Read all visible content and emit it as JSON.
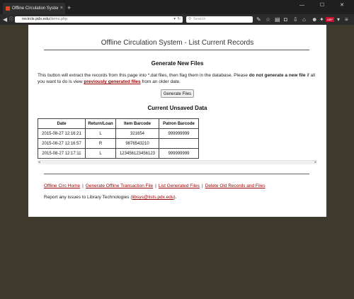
{
  "browser": {
    "tab_title": "Offline Circulation System - ...",
    "tab_close": "×",
    "new_tab": "+",
    "window_controls": "— ☐ ✕",
    "url_prefix": "",
    "url_host": "recircle.pdx.edu",
    "url_path": "/items.php",
    "search_placeholder": "Search",
    "adblock_badge": "ABP"
  },
  "page": {
    "title": "Offline Circulation System - List Current Records",
    "generate_heading": "Generate New Files",
    "para_pre": "This button will extract the records from this page into *.dat files, then flag them in the database. Please ",
    "para_bold": "do not generate a new file",
    "para_mid": " if all you want to do is view ",
    "para_link": "previously generated files",
    "para_post": " from an older date.",
    "generate_button": "Generate Files",
    "unsaved_heading": "Current Unsaved Data",
    "table": {
      "headers": [
        "Date",
        "Return/Loan",
        "Item Barcode",
        "Patron Barcode"
      ],
      "rows": [
        [
          "2015-08-27 12:16:21",
          "L",
          "321654",
          "999999999"
        ],
        [
          "2015-08-27 12:16:57",
          "R",
          "9876543210",
          ""
        ],
        [
          "2015-08-27 12:17:11",
          "L",
          "123456123456123",
          "999999999"
        ]
      ]
    },
    "footer_links": [
      "Offline Circ Home",
      "Generate Offline Transaction File",
      "List Generated Files",
      "Delete Old Records and Files"
    ],
    "link_separator": "|",
    "report_pre": "Report any issues to Library Technologies (",
    "report_email": "libsys@lists.pdx.edu",
    "report_post": ")."
  }
}
